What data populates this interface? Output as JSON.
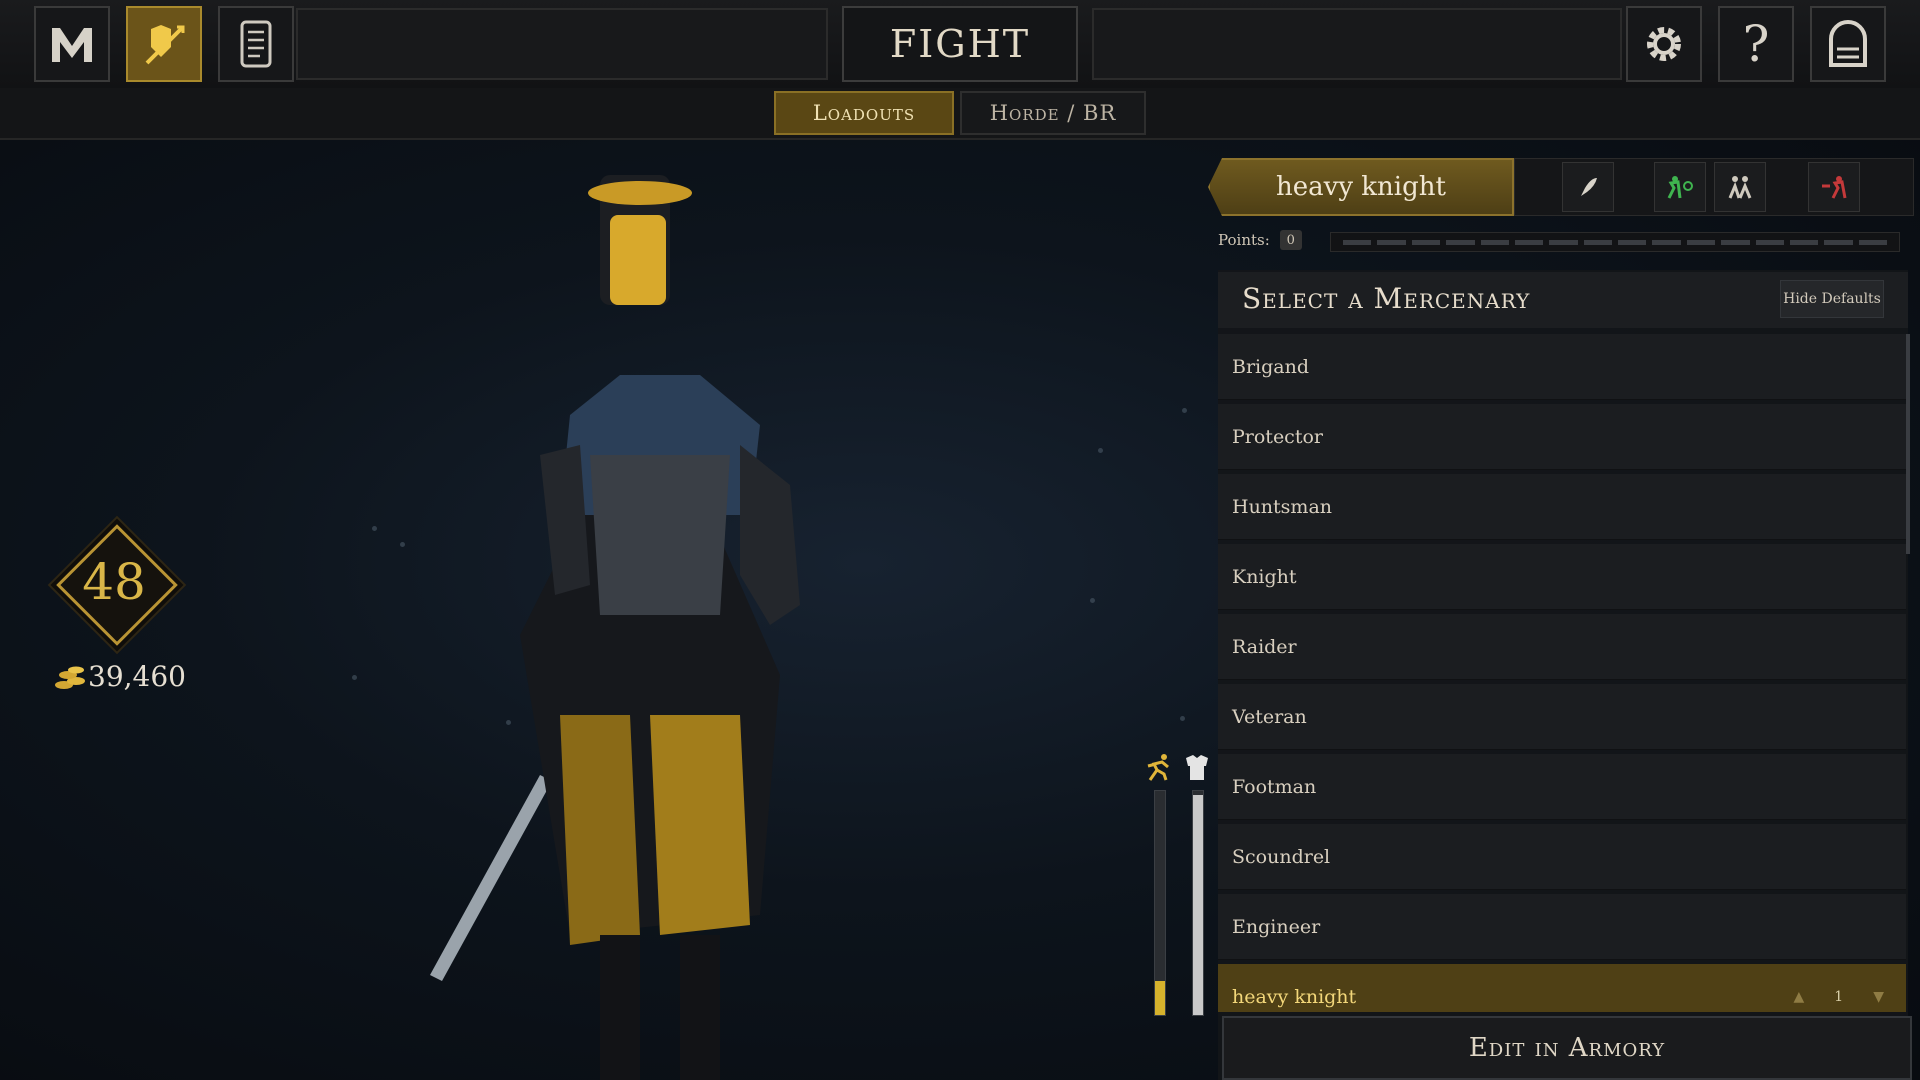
{
  "top_nav": {
    "main_menu_icon": "m-logo-icon",
    "loadout_icon": "armor-sword-icon",
    "log_icon": "scroll-icon",
    "title": "FIGHT",
    "settings_icon": "gear-icon",
    "help_icon": "question-icon",
    "exit_icon": "gate-icon"
  },
  "tabs": [
    {
      "label": "Loadouts",
      "active": true
    },
    {
      "label": "Horde / BR",
      "active": false
    }
  ],
  "player": {
    "level": "48",
    "gold": "39,460",
    "gold_icon": "coin-stack-icon"
  },
  "meters": {
    "speed_icon": "running-man-icon",
    "armor_icon": "armor-icon",
    "speed_level": 0.15,
    "armor_level": 0.98,
    "speed_color": "#d6b22c",
    "armor_color": "#c9c9c9"
  },
  "loadout": {
    "name": "heavy knight",
    "controls": [
      "quill-icon",
      "add-player-icon",
      "group-icon",
      "remove-player-icon"
    ],
    "points_label": "Points:",
    "points_value": "0"
  },
  "mercenary_panel": {
    "title": "Select a Mercenary",
    "hide_defaults": "Hide Defaults",
    "items": [
      {
        "label": "Brigand"
      },
      {
        "label": "Protector"
      },
      {
        "label": "Huntsman"
      },
      {
        "label": "Knight"
      },
      {
        "label": "Raider"
      },
      {
        "label": "Veteran"
      },
      {
        "label": "Footman"
      },
      {
        "label": "Scoundrel"
      },
      {
        "label": "Engineer"
      },
      {
        "label": "heavy knight",
        "selected": true,
        "order": "1"
      }
    ],
    "edit_button": "Edit in Armory"
  },
  "colors": {
    "accent_gold": "#b99434",
    "selected_row": "#4f4015",
    "selected_text": "#f3d77a"
  }
}
